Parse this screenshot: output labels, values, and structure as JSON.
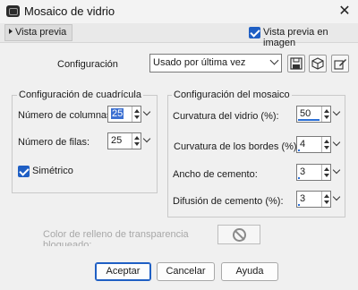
{
  "window": {
    "title": "Mosaico de vidrio",
    "close_label": "✕"
  },
  "preview": {
    "tab_label": "Vista previa",
    "checkbox_label": "Vista previa en imagen",
    "checked": true
  },
  "config": {
    "label": "Configuración",
    "selected": "Usado por última vez",
    "icons": [
      "save-icon",
      "cube-icon",
      "edit-icon"
    ]
  },
  "grid": {
    "title": "Configuración de cuadrícula",
    "columns_label": "Número de columnas:",
    "columns_value": "25",
    "rows_label": "Número de filas:",
    "rows_value": "25",
    "symmetric_label": "Simétrico",
    "symmetric_checked": true
  },
  "mosaic": {
    "title": "Configuración del mosaico",
    "fields": [
      {
        "label": "Curvatura del vidrio (%):",
        "value": "50"
      },
      {
        "label": "Curvatura de los bordes (%):",
        "value": "4"
      },
      {
        "label": "Ancho de cemento:",
        "value": "3"
      },
      {
        "label": "Difusión de cemento (%):",
        "value": "3"
      }
    ]
  },
  "fill": {
    "label_line1": "Color de relleno de transparencia",
    "label_line2": "bloqueado:"
  },
  "buttons": {
    "accept": "Aceptar",
    "cancel": "Cancelar",
    "help": "Ayuda"
  },
  "colors": {
    "accent": "#1f5fc4",
    "selection": "#3b6fd1",
    "background": "#f0f0f0"
  }
}
